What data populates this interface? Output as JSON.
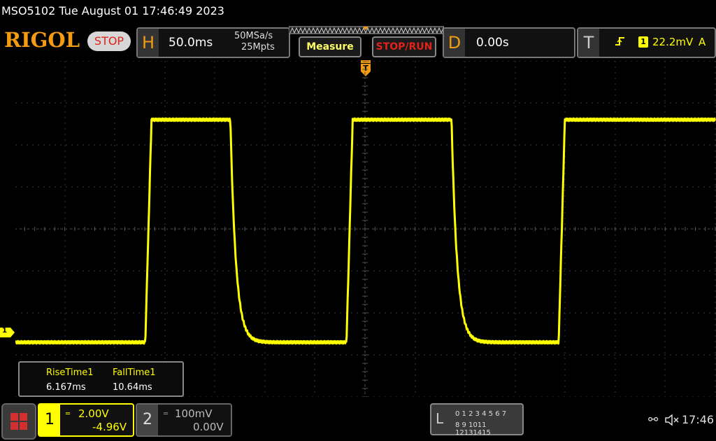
{
  "status_line": "MSO5102  Tue August 01 17:46:49 2023",
  "brand": "RIGOL",
  "run_state": "STOP",
  "horizontal": {
    "letter": "H",
    "timebase": "50.0ms",
    "sample_rate": "50MSa/s",
    "memory_depth": "25Mpts"
  },
  "buttons": {
    "measure": "Measure",
    "stop_run": "STOP/RUN"
  },
  "delay": {
    "letter": "D",
    "value": "0.00s"
  },
  "trigger": {
    "letter": "T",
    "source": "1",
    "level": "22.2mV",
    "mode": "A"
  },
  "trigger_marker": "T",
  "ch1_marker": "1",
  "measurements": {
    "items": [
      {
        "label": "RiseTime1",
        "value": "6.167ms"
      },
      {
        "label": "FallTime1",
        "value": "10.64ms"
      }
    ]
  },
  "channels": [
    {
      "number": "1",
      "scale": "2.00V",
      "offset": "-4.96V",
      "color": "#ffff00",
      "active": true
    },
    {
      "number": "2",
      "scale": "100mV",
      "offset": "0.00V",
      "color": "#888888",
      "active": false
    }
  ],
  "logic": {
    "letter": "L",
    "row1": "0 1 2 3  4 5 6 7",
    "row2": "8 9 1011 12131415"
  },
  "status_bar": {
    "clock": "17:46"
  },
  "colors": {
    "accent": "#f39c12",
    "trace": "#ffff00",
    "stop": "#e0231a"
  },
  "waveform": {
    "type": "square",
    "edges": [
      {
        "kind": "rise",
        "start_s": -0.2195
      },
      {
        "kind": "fall",
        "start_s": -0.1345
      },
      {
        "kind": "rise",
        "start_s": -0.0185
      },
      {
        "kind": "fall",
        "start_s": 0.0865
      },
      {
        "kind": "rise",
        "start_s": 0.1935
      }
    ],
    "low_div": -2.7,
    "high_div": 2.6
  }
}
